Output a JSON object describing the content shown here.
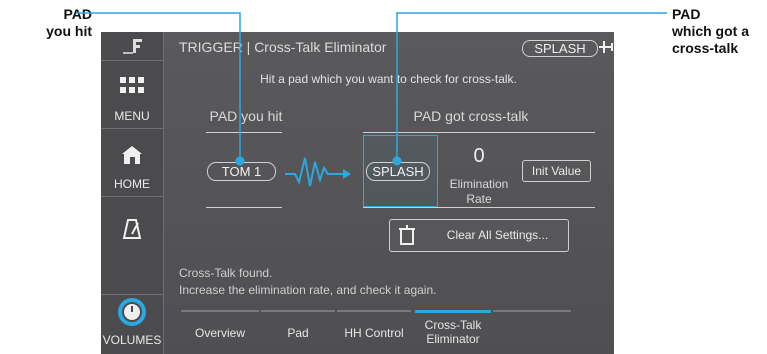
{
  "callouts": {
    "left_line1": "PAD",
    "left_line2": "you hit",
    "right_line1": "PAD",
    "right_line2": "which got a",
    "right_line3": "cross-talk"
  },
  "sidebar": {
    "menu": "MENU",
    "home": "HOME",
    "volumes": "VOLUMES"
  },
  "header": {
    "title": "TRIGGER | Cross-Talk Eliminator",
    "kit_pill": "SPLASH"
  },
  "instruction": "Hit a pad which you want to check for cross-talk.",
  "columns": {
    "hit_label": "PAD you hit",
    "got_label": "PAD got cross-talk"
  },
  "pads": {
    "hit": "TOM 1",
    "got": "SPLASH"
  },
  "elimination": {
    "value": "0",
    "label_line1": "Elimination",
    "label_line2": "Rate",
    "init_button": "Init Value"
  },
  "clear_button": "Clear All Settings...",
  "status": {
    "line1": "Cross-Talk found.",
    "line2": "Increase the elimination rate, and check it again."
  },
  "tabs": [
    {
      "label": "Overview",
      "active": false
    },
    {
      "label": "Pad",
      "active": false
    },
    {
      "label": "HH Control",
      "active": false
    },
    {
      "label_line1": "Cross-Talk",
      "label_line2": "Eliminator",
      "active": true
    }
  ],
  "colors": {
    "accent": "#2aa9e0",
    "callout_line": "#2aa9e0"
  }
}
